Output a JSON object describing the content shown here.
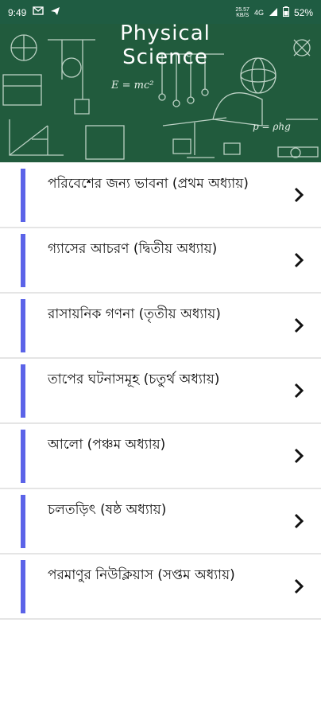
{
  "status": {
    "time": "9:49",
    "speed_value": "25.57",
    "speed_unit": "KB/S",
    "network": "4G",
    "battery": "52%"
  },
  "banner": {
    "title_line1": "Physical",
    "title_line2": "Science",
    "formula_energy": "E = mc²",
    "formula_pressure": "p = ρhg"
  },
  "chapters": [
    {
      "label": "পরিবেশের জন্য ভাবনা (প্রথম অধ্যায়)"
    },
    {
      "label": "গ্যাসের আচরণ (দ্বিতীয় অধ্যায়)"
    },
    {
      "label": "রাসায়নিক গণনা (তৃতীয় অধ্যায়)"
    },
    {
      "label": "তাপের ঘটনাসমূহ (চতুর্থ অধ্যায়)"
    },
    {
      "label": "আলো (পঞ্চম অধ্যায়)"
    },
    {
      "label": "চলতড়িৎ (ষষ্ঠ অধ্যায়)"
    },
    {
      "label": "পরমাণুর নিউক্লিয়াস (সপ্তম অধ্যায়)"
    }
  ],
  "colors": {
    "accent_bar": "#5b63e8",
    "banner_bg": "#215b3d",
    "divider": "#e5e5e5"
  },
  "icons": {
    "row_chevron": "chevron-right-icon"
  }
}
